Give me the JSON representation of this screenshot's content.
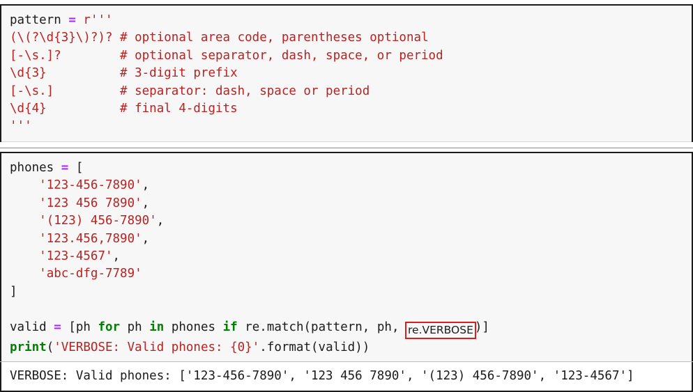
{
  "colors": {
    "cell_background": "#f7f7f7",
    "output_background": "#ffffff",
    "border": "#1a1a1a",
    "divider": "#8c8c8c",
    "string": "#ba2121",
    "keyword": "#008000",
    "operator": "#aa22ff",
    "plain_text": "#1b1b1b",
    "annotation_box": "#e01b1b"
  },
  "cells": [
    {
      "id": "pattern-cell",
      "lines": [
        [
          {
            "t": "pattern",
            "c": "name"
          },
          {
            "t": " ",
            "c": "punct"
          },
          {
            "t": "=",
            "c": "op"
          },
          {
            "t": " ",
            "c": "punct"
          },
          {
            "t": "r'''",
            "c": "str"
          }
        ],
        [
          {
            "t": "(\\(?\\d{3}\\)?)? # optional area code, parentheses optional",
            "c": "str"
          }
        ],
        [
          {
            "t": "[-\\s.]?        # optional separator, dash, space, or period",
            "c": "str"
          }
        ],
        [
          {
            "t": "\\d{3}          # 3-digit prefix",
            "c": "str"
          }
        ],
        [
          {
            "t": "[-\\s.]         # separator: dash, space or period",
            "c": "str"
          }
        ],
        [
          {
            "t": "\\d{4}          # final 4-digits",
            "c": "str"
          }
        ],
        [
          {
            "t": "'''",
            "c": "str"
          }
        ]
      ]
    },
    {
      "id": "phones-cell",
      "lines": [
        [
          {
            "t": "phones",
            "c": "name"
          },
          {
            "t": " ",
            "c": "punct"
          },
          {
            "t": "=",
            "c": "op"
          },
          {
            "t": " [",
            "c": "punct"
          }
        ],
        [
          {
            "t": "    ",
            "c": "punct"
          },
          {
            "t": "'123-456-7890'",
            "c": "str"
          },
          {
            "t": ",",
            "c": "punct"
          }
        ],
        [
          {
            "t": "    ",
            "c": "punct"
          },
          {
            "t": "'123 456 7890'",
            "c": "str"
          },
          {
            "t": ",",
            "c": "punct"
          }
        ],
        [
          {
            "t": "    ",
            "c": "punct"
          },
          {
            "t": "'(123) 456-7890'",
            "c": "str"
          },
          {
            "t": ",",
            "c": "punct"
          }
        ],
        [
          {
            "t": "    ",
            "c": "punct"
          },
          {
            "t": "'123.456,7890'",
            "c": "str"
          },
          {
            "t": ",",
            "c": "punct"
          }
        ],
        [
          {
            "t": "    ",
            "c": "punct"
          },
          {
            "t": "'123-4567'",
            "c": "str"
          },
          {
            "t": ",",
            "c": "punct"
          }
        ],
        [
          {
            "t": "    ",
            "c": "punct"
          },
          {
            "t": "'abc-dfg-7789'",
            "c": "str"
          }
        ],
        [
          {
            "t": "]",
            "c": "punct"
          }
        ],
        [
          {
            "t": "",
            "c": "punct"
          }
        ],
        [
          {
            "t": "valid",
            "c": "name"
          },
          {
            "t": " ",
            "c": "punct"
          },
          {
            "t": "=",
            "c": "op"
          },
          {
            "t": " [ph ",
            "c": "punct"
          },
          {
            "t": "for",
            "c": "kw"
          },
          {
            "t": " ph ",
            "c": "punct"
          },
          {
            "t": "in",
            "c": "kw"
          },
          {
            "t": " phones ",
            "c": "punct"
          },
          {
            "t": "if",
            "c": "kw"
          },
          {
            "t": " re.match(pattern, ph, ",
            "c": "punct"
          },
          {
            "t": "re.VERBOSE",
            "c": "annot"
          },
          {
            "t": ")]",
            "c": "punct"
          }
        ],
        [
          {
            "t": "print",
            "c": "kw"
          },
          {
            "t": "(",
            "c": "punct"
          },
          {
            "t": "'VERBOSE: Valid phones: {0}'",
            "c": "str"
          },
          {
            "t": ".format(valid))",
            "c": "punct"
          }
        ]
      ]
    }
  ],
  "output": {
    "id": "stdout-output",
    "text": "VERBOSE: Valid phones: ['123-456-7890', '123 456 7890', '(123) 456-7890', '123-4567']"
  },
  "annotation": {
    "label": "re.VERBOSE",
    "shape": "rectangle",
    "color": "#e01b1b"
  }
}
